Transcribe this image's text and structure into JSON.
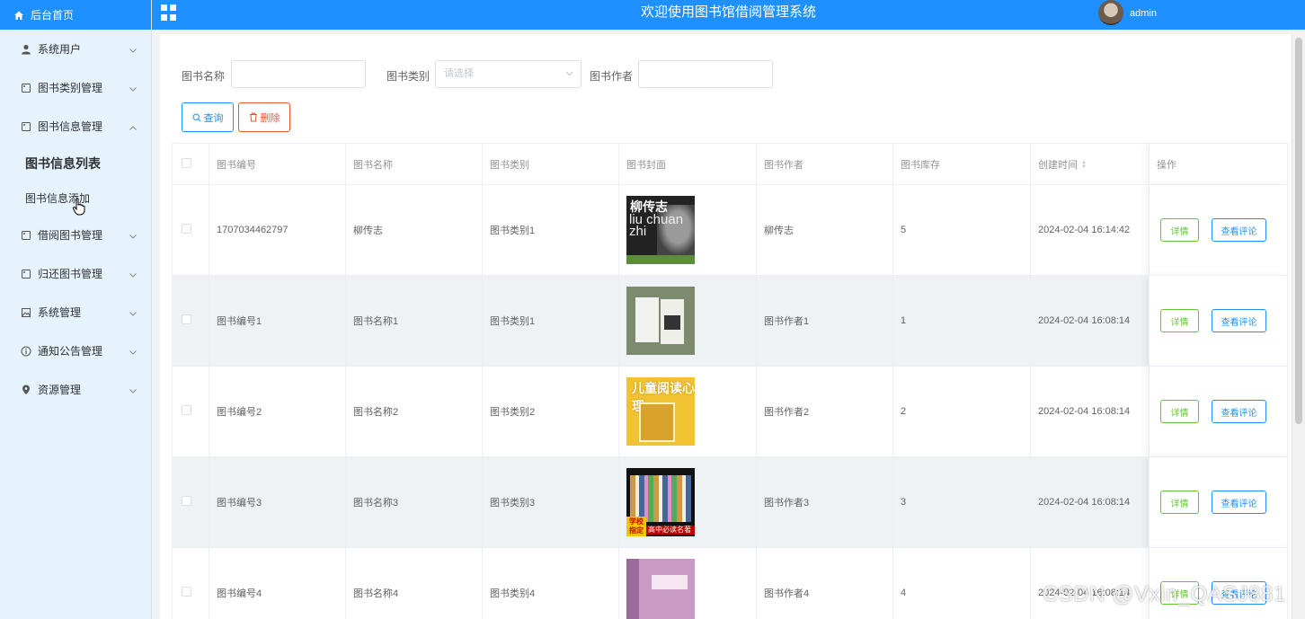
{
  "sidebar": {
    "home_label": "后台首页",
    "items": [
      {
        "label": "系统用户",
        "icon": "user-icon"
      },
      {
        "label": "图书类别管理",
        "icon": "tag-icon"
      },
      {
        "label": "图书信息管理",
        "icon": "tag-icon",
        "expanded": true,
        "children": [
          {
            "label": "图书信息列表",
            "active": true
          },
          {
            "label": "图书信息添加"
          }
        ]
      },
      {
        "label": "借阅图书管理",
        "icon": "tag-icon"
      },
      {
        "label": "归还图书管理",
        "icon": "tag-icon"
      },
      {
        "label": "系统管理",
        "icon": "picture-icon"
      },
      {
        "label": "通知公告管理",
        "icon": "info-icon"
      },
      {
        "label": "资源管理",
        "icon": "location-icon"
      }
    ]
  },
  "header": {
    "title": "欢迎使用图书馆借阅管理系统",
    "username": "admin"
  },
  "filters": {
    "name_label": "图书名称",
    "name_value": "",
    "category_label": "图书类别",
    "category_placeholder": "请选择",
    "author_label": "图书作者",
    "author_value": ""
  },
  "actions": {
    "query_label": "查询",
    "delete_label": "删除"
  },
  "table": {
    "columns": [
      "图书编号",
      "图书名称",
      "图书类别",
      "图书封面",
      "图书作者",
      "图书库存",
      "创建时间",
      "操作"
    ],
    "detail_label": "详情",
    "comment_label": "查看评论",
    "rows": [
      {
        "id": "1707034462797",
        "name": "柳传志",
        "category": "图书类别1",
        "author": "柳传志",
        "stock": "5",
        "created": "2024-02-04 16:14:42"
      },
      {
        "id": "图书编号1",
        "name": "图书名称1",
        "category": "图书类别1",
        "author": "图书作者1",
        "stock": "1",
        "created": "2024-02-04 16:08:14"
      },
      {
        "id": "图书编号2",
        "name": "图书名称2",
        "category": "图书类别2",
        "author": "图书作者2",
        "stock": "2",
        "created": "2024-02-04 16:08:14"
      },
      {
        "id": "图书编号3",
        "name": "图书名称3",
        "category": "图书类别3",
        "author": "图书作者3",
        "stock": "3",
        "created": "2024-02-04 16:08:14"
      },
      {
        "id": "图书编号4",
        "name": "图书名称4",
        "category": "图书类别4",
        "author": "图书作者4",
        "stock": "4",
        "created": "2024-02-04 16:08:14"
      }
    ]
  },
  "covers": {
    "cover1_title": "柳传志",
    "cover1_sub": "liu chuan zhi",
    "cover3_title": "儿童阅读心理",
    "cover4_tag": "学校指定",
    "cover4_line": "高中必读名著"
  },
  "watermark": "CSDN @Vxin_QASJ881",
  "colors": {
    "primary": "#1e90ff",
    "danger": "#e4572e",
    "success": "#67c23a",
    "sidebar_bg": "#e6f3fc"
  }
}
